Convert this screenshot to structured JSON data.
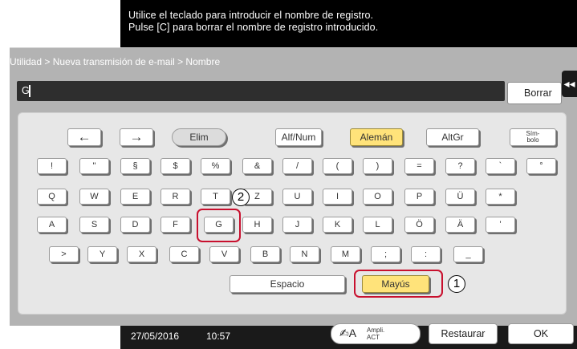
{
  "message": {
    "line1": "Utilice el teclado para introducir el nombre de registro.",
    "line2": "Pulse [C] para borrar el nombre de registro introducido."
  },
  "breadcrumb": "Utilidad > Nueva transmisión de e-mail > Nombre",
  "input": {
    "value": "G"
  },
  "buttons": {
    "borrar": "Borrar",
    "collapse_icon": "double-chevron-left-icon",
    "collapse_glyph": "◂◂"
  },
  "keyboard": {
    "top_row": {
      "left_arrow": "←",
      "right_arrow": "→",
      "delete": "Elim",
      "alfnum": "Alf/Num",
      "language": "Alemán",
      "altgr": "AltGr",
      "symbol_line1": "Sím-",
      "symbol_line2": "bolo"
    },
    "row1": [
      "!",
      "\"",
      "§",
      "$",
      "%",
      "&",
      "/",
      "(",
      ")",
      "=",
      "?",
      "`",
      "°"
    ],
    "row2": [
      "Q",
      "W",
      "E",
      "R",
      "T",
      "Z",
      "U",
      "I",
      "O",
      "P",
      "Ü",
      "*"
    ],
    "row3": [
      "A",
      "S",
      "D",
      "F",
      "G",
      "H",
      "J",
      "K",
      "L",
      "Ö",
      "Ä",
      "'"
    ],
    "row4": [
      ">",
      "Y",
      "X",
      "C",
      "V",
      "B",
      "N",
      "M",
      ";",
      ":",
      "_"
    ],
    "space": "Espacio",
    "shift": "Mayús"
  },
  "annotations": {
    "marker1": "1",
    "marker2": "2"
  },
  "status": {
    "date": "27/05/2016",
    "time": "10:57"
  },
  "footer": {
    "ampli_line1": "Ampli.",
    "ampli_line2": "ACT",
    "ampli_icon": "ampli-glyph-icon",
    "restaurar": "Restaurar",
    "ok": "OK"
  },
  "colors": {
    "accent_yellow": "#ffe37a",
    "marker_red": "#c8102e"
  }
}
